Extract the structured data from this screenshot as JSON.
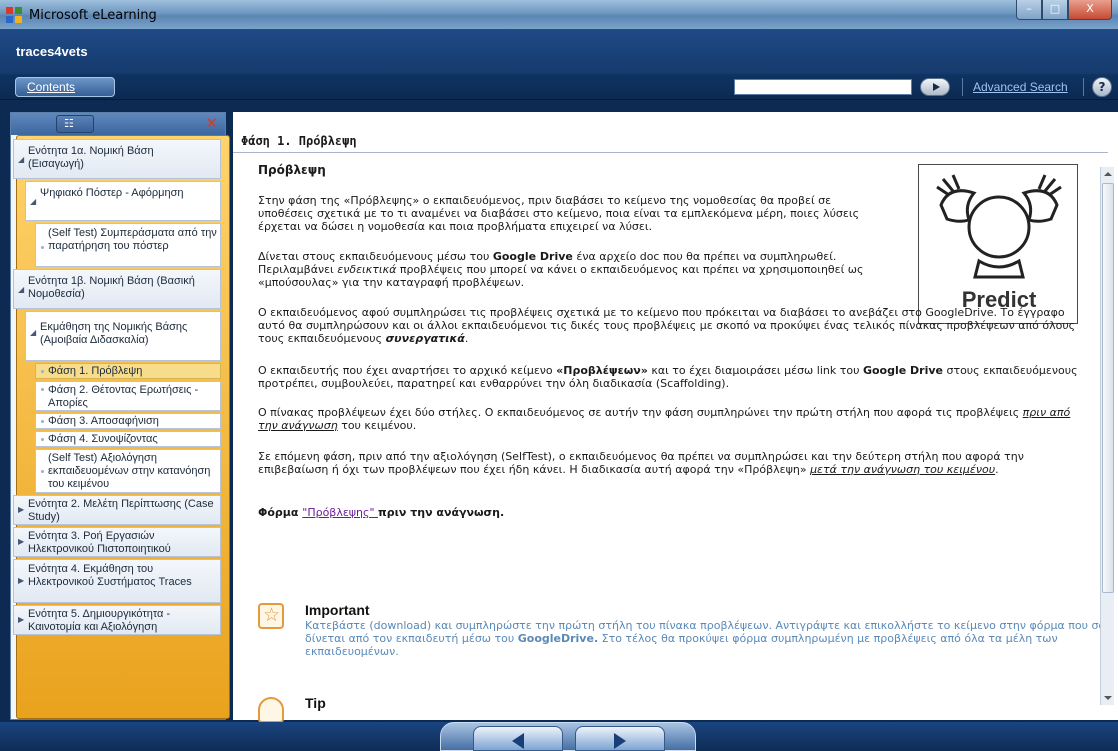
{
  "window": {
    "title": "Microsoft eLearning",
    "controls": {
      "minimize": "–",
      "maximize": "□",
      "close": "X"
    }
  },
  "app": {
    "name": "traces4vets"
  },
  "toolbar": {
    "contents_label": "Contents",
    "search_value": "",
    "advanced_search": "Advanced Search",
    "help": "?"
  },
  "sidebar": {
    "items": [
      {
        "label": "Ενότητα 1α. Νομική Βάση (Εισαγωγή)",
        "level": 0,
        "expanded": true
      },
      {
        "label": "Ψηφιακό Πόστερ - Αφόρμηση",
        "level": 1,
        "expanded": true
      },
      {
        "label": "(Self Test) Συμπεράσματα από την παρατήρηση του πόστερ",
        "level": 2
      },
      {
        "label": "Ενότητα 1β. Νομική Βάση (Βασική Νομοθεσία)",
        "level": 0,
        "expanded": true
      },
      {
        "label": "Εκμάθηση της Νομικής Βάσης (Αμοιβαία Διδασκαλία)",
        "level": 1,
        "expanded": true
      },
      {
        "label": "Φάση 1. Πρόβλεψη",
        "level": 2,
        "selected": true
      },
      {
        "label": "Φάση 2. Θέτοντας Ερωτήσεις - Απορίες",
        "level": 2
      },
      {
        "label": "Φάση 3. Αποσαφήνιση",
        "level": 2
      },
      {
        "label": "Φάση 4. Συνοψίζοντας",
        "level": 2
      },
      {
        "label": "(Self Test) Αξιολόγηση εκπαιδευομένων στην κατανόηση του κειμένου",
        "level": 2
      },
      {
        "label": "Ενότητα 2. Μελέτη Περίπτωσης (Case Study)",
        "level": 0
      },
      {
        "label": "Ενότητα 3. Ροή Εργασιών Ηλεκτρονικού Πιστοποιητικού",
        "level": 0
      },
      {
        "label": "Ενότητα 4. Εκμάθηση του Ηλεκτρονικού Συστήματος Traces",
        "level": 0
      },
      {
        "label": "Ενότητα 5. Δημιουργικότητα - Καινοτομία και Αξιολόγηση",
        "level": 0
      }
    ]
  },
  "main": {
    "page_title": "Φάση 1. Πρόβλεψη",
    "subtitle": "Πρόβλεψη",
    "image_caption": "Predict",
    "p1": "Στην φάση της «Πρόβλεψης» ο εκπαιδευόμενος, πριν διαβάσει το κείμενο της νομοθεσίας θα προβεί σε υποθέσεις σχετικά με το τι αναμένει να διαβάσει στο κείμενο, ποια είναι τα εμπλεκόμενα μέρη, ποιες λύσεις έρχεται να δώσει η νομοθεσία και ποια προβλήματα επιχειρεί να λύσει.",
    "p2": {
      "a": "Δίνεται στους εκπαιδευόμενους μέσω του ",
      "b": "Google Drive",
      "c": " ένα αρχείο doc που θα πρέπει να συμπληρωθεί. Περιλαμβάνει ",
      "d": "ενδεικτικά",
      "e": " προβλέψεις που μπορεί να κάνει ο εκπαιδευόμενος και πρέπει να χρησιμοποιηθεί ως «μπούσουλας» για την καταγραφή προβλέψεων."
    },
    "p3": {
      "a": "Ο εκπαιδευόμενος αφού συμπληρώσει τις προβλέψεις σχετικά με το κείμενο που πρόκειται να διαβάσει το ανεβάζει στο GoogleDrive. Το έγγραφο αυτό θα συμπληρώσουν και οι άλλοι εκπαιδευόμενοι τις δικές τους προβλέψεις με σκοπό να προκύψει ένας τελικός πίνακας προβλέψεων από όλους τους εκπαιδευόμενους ",
      "b": "συνεργατικά",
      "c": "."
    },
    "p4": {
      "a": "Ο εκπαιδευτής που έχει αναρτήσει το αρχικό κείμενο ",
      "b": "«Προβλέψεων»",
      "c": " και το έχει διαμοιράσει μέσω link του ",
      "d": "Google Drive",
      "e": " στους εκπαιδευόμενους προτρέπει, συμβουλεύει, παρατηρεί και ενθαρρύνει την όλη διαδικασία (Scaffolding)."
    },
    "p5": {
      "a": "Ο πίνακας προβλέψεων έχει δύο στήλες. Ο εκπαιδευόμενος σε αυτήν την φάση συμπληρώνει την πρώτη στήλη που αφορά τις προβλέψεις ",
      "b": "πριν από την ανάγνωση",
      "c": " του κειμένου."
    },
    "p6": {
      "a": "Σε επόμενη φάση, πριν από την αξιολόγηση (SelfTest), ο εκπαιδευόμενος θα πρέπει να συμπληρώσει και την δεύτερη στήλη που αφορά την επιβεβαίωση ή όχι των προβλέψεων που έχει ήδη κάνει. Η διαδικασία αυτή αφορά την «Πρόβλεψη» ",
      "b": "μετά την ανάγνωση του κειμένου",
      "c": "."
    },
    "form_line": {
      "a": "Φόρμα ",
      "link": "\"Πρόβλεψης\" ",
      "b": "πριν την ανάγνωση."
    },
    "important": {
      "title": "Important",
      "a": "Κατεβάστε (download) και συμπληρώστε την πρώτη στήλη του πίνακα προβλέψεων. Αντιγράψτε και επικολλήστε το κείμενο στην φόρμα που σας δίνεται από τον εκπαιδευτή μέσω του ",
      "b": "GoogleDrive.",
      "c": " Στο τέλος θα προκύψει φόρμα συμπληρωμένη με προβλέψεις από όλα τα μέλη των εκπαιδευομένων."
    },
    "tip": {
      "title": "Tip"
    }
  },
  "icons": {
    "app": "app-icon",
    "important": "star-icon",
    "tip": "tip-icon",
    "prev": "arrow-left-icon",
    "next": "arrow-right-icon"
  },
  "colors": {
    "accent": "#163a6d",
    "selected": "#f7dd8b",
    "important_text": "#5a89b8",
    "link": "#6a1b9a"
  }
}
